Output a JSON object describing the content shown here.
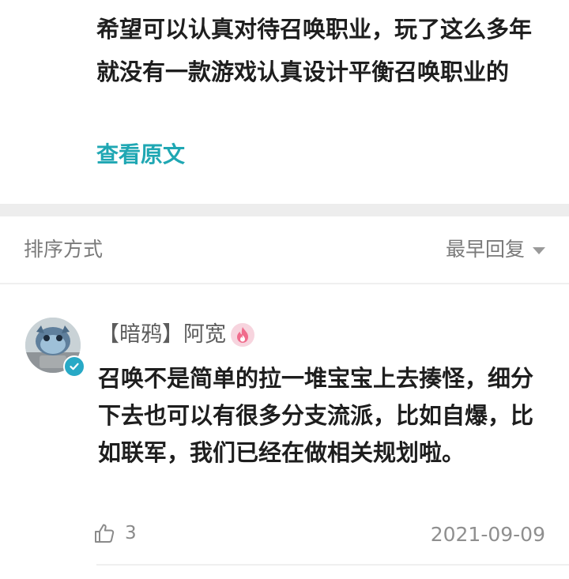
{
  "post": {
    "text": "希望可以认真对待召唤职业，玩了这么多年就没有一款游戏认真设计平衡召唤职业的",
    "view_original": "查看原文"
  },
  "sort": {
    "label": "排序方式",
    "selected": "最早回复"
  },
  "reply": {
    "author": "【暗鸦】阿宽",
    "text": "召唤不是简单的拉一堆宝宝上去揍怪，细分下去也可以有很多分支流派，比如自爆，比如联军，我们已经在做相关规划啦。",
    "likes": "3",
    "date": "2021-09-09"
  },
  "icons": {
    "avatar": "avatar-image",
    "verified": "verified-check-icon",
    "level": "flame-level-icon",
    "like": "thumbs-up-icon",
    "sort_caret": "caret-down-icon"
  },
  "colors": {
    "accent": "#1fa7b3",
    "verified": "#28a9c6",
    "level_badge": "#f06b8c",
    "divider": "#ededed"
  }
}
